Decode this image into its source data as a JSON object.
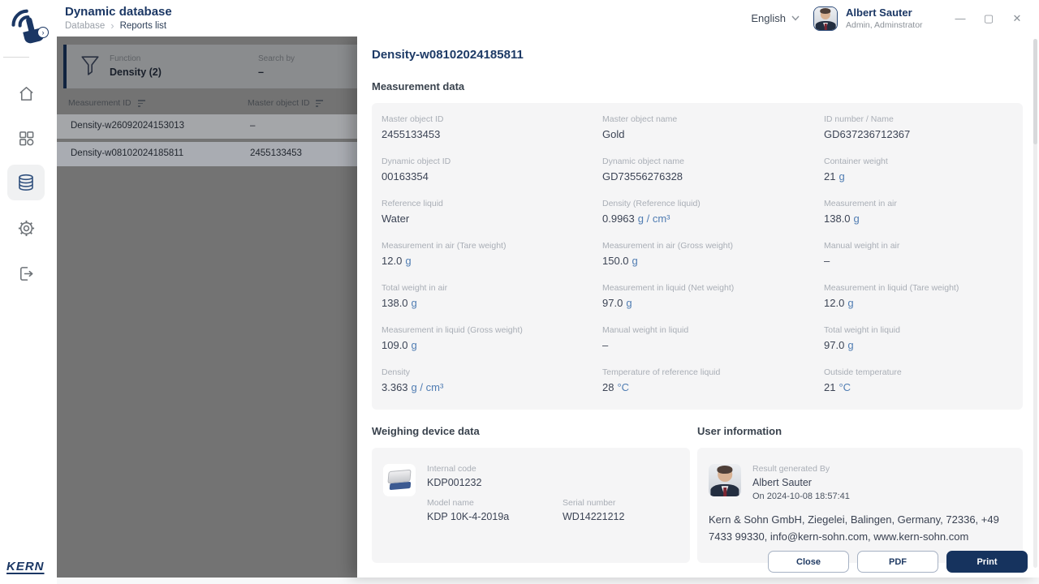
{
  "app": {
    "title": "Dynamic database",
    "breadcrumb": {
      "parent": "Database",
      "separator": "›",
      "current": "Reports list"
    },
    "language": "English",
    "user": {
      "name": "Albert Sauter",
      "role": "Admin, Adminstrator"
    },
    "window": {
      "minimize": "—",
      "maximize": "▢",
      "close": "✕"
    },
    "logo_text": "KERN",
    "expand_glyph": "›"
  },
  "icons": {
    "sidebar": [
      "home-icon",
      "apps-grid-icon",
      "database-icon",
      "settings-gear-icon",
      "logout-icon"
    ],
    "filter": "funnel-icon",
    "language": "chevron-down-icon"
  },
  "colors": {
    "navy": "#1b3764",
    "unit_blue": "#4f7cb2",
    "card_bg": "#f5f5f6",
    "primary_button": "#16335e",
    "overlay_gray": "#737373"
  },
  "list_panel": {
    "filter": {
      "function_label": "Function",
      "function_value": "Density (2)",
      "search_label": "Search by",
      "search_value": "–"
    },
    "columns": {
      "col1": "Measurement ID",
      "col2": "Master object ID"
    },
    "rows": [
      {
        "measurement_id": "Density-w26092024153013",
        "master_object_id": "–"
      },
      {
        "measurement_id": "Density-w08102024185811",
        "master_object_id": "2455133453"
      }
    ]
  },
  "detail": {
    "title": "Density-w08102024185811",
    "section_title": "Measurement data",
    "fields": [
      {
        "label": "Master object ID",
        "value": "2455133453",
        "unit": ""
      },
      {
        "label": "Master object name",
        "value": "Gold",
        "unit": ""
      },
      {
        "label": "ID number / Name",
        "value": "GD637236712367",
        "unit": ""
      },
      {
        "label": "Dynamic object ID",
        "value": "00163354",
        "unit": ""
      },
      {
        "label": "Dynamic object name",
        "value": "GD73556276328",
        "unit": ""
      },
      {
        "label": "Container weight",
        "value": "21",
        "unit": "g"
      },
      {
        "label": "Reference liquid",
        "value": "Water",
        "unit": ""
      },
      {
        "label": "Density (Reference liquid)",
        "value": "0.9963",
        "unit": "g / cm³"
      },
      {
        "label": "Measurement in air",
        "value": "138.0",
        "unit": "g"
      },
      {
        "label": "Measurement in air (Tare weight)",
        "value": "12.0",
        "unit": "g"
      },
      {
        "label": "Measurement in air (Gross weight)",
        "value": "150.0",
        "unit": "g"
      },
      {
        "label": "Manual weight in air",
        "value": "–",
        "unit": ""
      },
      {
        "label": "Total weight in air",
        "value": "138.0",
        "unit": "g"
      },
      {
        "label": "Measurement in liquid (Net weight)",
        "value": "97.0",
        "unit": "g"
      },
      {
        "label": "Measurement in liquid (Tare weight)",
        "value": "12.0",
        "unit": "g"
      },
      {
        "label": "Measurement in liquid (Gross weight)",
        "value": "109.0",
        "unit": "g"
      },
      {
        "label": "Manual weight in liquid",
        "value": "–",
        "unit": ""
      },
      {
        "label": "Total weight in liquid",
        "value": "97.0",
        "unit": "g"
      },
      {
        "label": "Density",
        "value": "3.363",
        "unit": "g / cm³"
      },
      {
        "label": "Temperature of reference liquid",
        "value": "28",
        "unit": "°C"
      },
      {
        "label": "Outside temperature",
        "value": "21",
        "unit": "°C"
      }
    ],
    "weighing_device": {
      "section_title": "Weighing device data",
      "internal_code_label": "Internal code",
      "internal_code": "KDP001232",
      "model_name_label": "Model name",
      "model_name": "KDP 10K-4-2019a",
      "serial_number_label": "Serial number",
      "serial_number": "WD14221212"
    },
    "user_information": {
      "section_title": "User information",
      "generated_by_label": "Result generated By",
      "generated_by": "Albert Sauter",
      "generated_on": "On 2024-10-08 18:57:41",
      "company": "Kern & Sohn GmbH, Ziegelei, Balingen, Germany, 72336, +49 7433 99330, info@kern-sohn.com, www.kern-sohn.com"
    },
    "actions": {
      "close": "Close",
      "pdf": "PDF",
      "print": "Print"
    }
  }
}
